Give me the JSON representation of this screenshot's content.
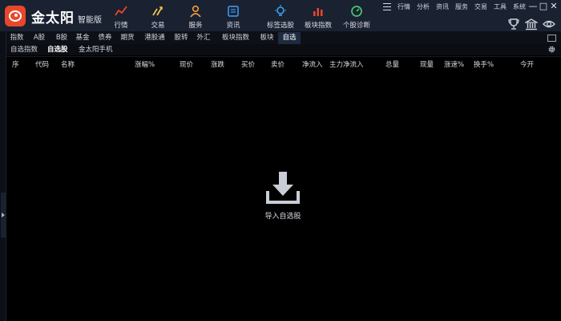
{
  "app": {
    "brand": "金太阳",
    "edition": "智能版"
  },
  "nav": [
    {
      "label": "行情",
      "icon": "trend-chart-icon"
    },
    {
      "label": "交易",
      "icon": "trade-icon"
    },
    {
      "label": "服务",
      "icon": "user-icon"
    },
    {
      "label": "资讯",
      "icon": "news-icon"
    },
    {
      "label": "标签选股",
      "icon": "bulb-icon"
    },
    {
      "label": "板块指数",
      "icon": "bar-chart-icon"
    },
    {
      "label": "个股诊断",
      "icon": "gauge-icon"
    }
  ],
  "mini_menu": [
    "行情",
    "分析",
    "资讯",
    "服务",
    "交易",
    "工具",
    "系统"
  ],
  "window_controls": {
    "minimize": "—",
    "maximize": "□",
    "close": "✕"
  },
  "market_tabs": [
    "指数",
    "A股",
    "B股",
    "基金",
    "债券",
    "期货",
    "港股通",
    "股转",
    "外汇",
    "板块指数",
    "板块",
    "自选"
  ],
  "market_tab_active": "自选",
  "sub_tabs": [
    "自选指数",
    "自选股",
    "金太阳手机"
  ],
  "sub_tab_active": "自选股",
  "columns": [
    "序",
    "代码",
    "名称",
    "涨幅%",
    "现价",
    "涨跌",
    "买价",
    "卖价",
    "净流入",
    "主力净流入",
    "总量",
    "现量",
    "涨速%",
    "换手%",
    "今开"
  ],
  "empty_state": {
    "label": "导入自选股",
    "icon": "import-download-icon"
  },
  "colors": {
    "accent_red": "#e8472c",
    "topbar_bg": "#1a2130",
    "active_tab_bg": "#1d2a40"
  }
}
